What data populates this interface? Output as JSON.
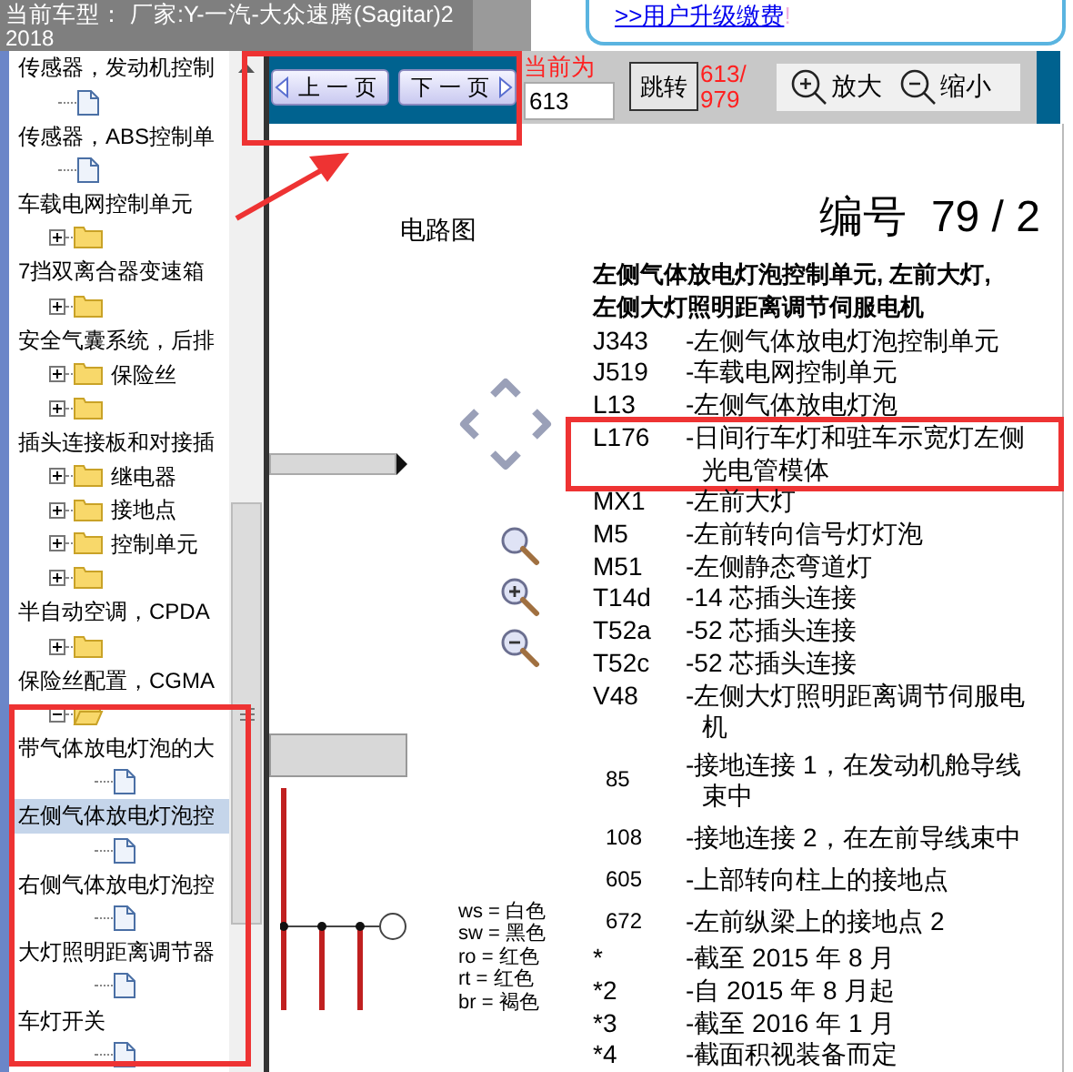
{
  "header": {
    "title": "当前车型：  厂家:Y-一汽-大众速腾(Sagitar)2",
    "title_line_2": "2018",
    "upgrade_link": ">>用户升级缴费",
    "upgrade_mark": "!"
  },
  "tree": [
    {
      "kind": "heading",
      "label": "传感器，发动机控制",
      "selected": false,
      "children": [
        {
          "kind": "doc"
        }
      ]
    },
    {
      "kind": "heading",
      "label": "传感器，ABS控制单",
      "selected": false,
      "children": [
        {
          "kind": "doc"
        }
      ]
    },
    {
      "kind": "heading",
      "label": "车载电网控制单元",
      "selected": false,
      "children": [
        {
          "kind": "folder",
          "expanded": false
        }
      ]
    },
    {
      "kind": "heading",
      "label": "7挡双离合器变速箱",
      "selected": false,
      "children": [
        {
          "kind": "folder",
          "expanded": false
        }
      ]
    },
    {
      "kind": "heading",
      "label": "安全气囊系统，后排",
      "selected": false,
      "children": [
        {
          "kind": "folder",
          "label": "保险丝",
          "expanded": false
        },
        {
          "kind": "folder",
          "expanded": false
        }
      ]
    },
    {
      "kind": "heading",
      "label": "插头连接板和对接插",
      "selected": false,
      "children": [
        {
          "kind": "folder",
          "label": "继电器",
          "expanded": false
        },
        {
          "kind": "folder",
          "label": "接地点",
          "expanded": false
        },
        {
          "kind": "folder",
          "label": "控制单元",
          "expanded": false
        },
        {
          "kind": "folder",
          "expanded": false
        }
      ]
    },
    {
      "kind": "heading",
      "label": "半自动空调，CPDA",
      "selected": false,
      "children": [
        {
          "kind": "folder",
          "expanded": false
        }
      ]
    },
    {
      "kind": "heading",
      "label": "保险丝配置，CGMA",
      "selected": false,
      "children": [
        {
          "kind": "folder",
          "expanded": true,
          "children": [
            {
              "kind": "heading",
              "label": "带气体放电灯泡的大",
              "selected": false,
              "children": [
                {
                  "kind": "doc"
                }
              ]
            },
            {
              "kind": "heading",
              "label": "左侧气体放电灯泡控",
              "selected": true,
              "children": [
                {
                  "kind": "doc"
                }
              ]
            },
            {
              "kind": "heading",
              "label": "右侧气体放电灯泡控",
              "selected": false,
              "children": [
                {
                  "kind": "doc"
                }
              ]
            },
            {
              "kind": "heading",
              "label": "大灯照明距离调节器",
              "selected": false,
              "children": [
                {
                  "kind": "doc"
                }
              ]
            },
            {
              "kind": "heading",
              "label": "车灯开关",
              "selected": false,
              "children": [
                {
                  "kind": "doc"
                }
              ]
            }
          ]
        }
      ]
    }
  ],
  "toolbar": {
    "prev": "上 一 页",
    "next": "下 一 页",
    "current_label": "当前为",
    "page_value": "613",
    "jump": "跳转",
    "page_status": [
      "613/",
      "979"
    ],
    "zoom_in": "放大",
    "zoom_out": "缩小"
  },
  "document": {
    "diagram_label": "电路图",
    "number": "编号  79 / 2",
    "heading": "左侧气体放电灯泡控制单元, 左前大灯, 左侧大灯照明距离调节伺服电机",
    "legend": [
      {
        "kind": "part",
        "code": "J343",
        "text": "-左侧气体放电灯泡控制单元",
        "highlighted": false
      },
      {
        "kind": "part",
        "code": "J519",
        "text": "-车载电网控制单元",
        "highlighted": false
      },
      {
        "kind": "part",
        "code": "L13",
        "text": "-左侧气体放电灯泡",
        "highlighted": false
      },
      {
        "kind": "part",
        "code": "L176",
        "text": "-日间行车灯和驻车示宽灯左侧光电管模体",
        "highlighted": true
      },
      {
        "kind": "part",
        "code": "MX1",
        "text": "-左前大灯",
        "highlighted": false
      },
      {
        "kind": "part",
        "code": "M5",
        "text": "-左前转向信号灯灯泡",
        "highlighted": false
      },
      {
        "kind": "part",
        "code": "M51",
        "text": "-左侧静态弯道灯",
        "highlighted": false
      },
      {
        "kind": "part",
        "code": "T14d",
        "text": "-14 芯插头连接",
        "highlighted": false
      },
      {
        "kind": "part",
        "code": "T52a",
        "text": "-52 芯插头连接",
        "highlighted": false
      },
      {
        "kind": "part",
        "code": "T52c",
        "text": "-52 芯插头连接",
        "highlighted": false
      },
      {
        "kind": "part",
        "code": "V48",
        "text": "-左侧大灯照明距离调节伺服电机",
        "highlighted": false
      },
      {
        "kind": "ground",
        "code": "85",
        "text": "-接地连接 1，在发动机舱导线束中",
        "highlighted": false
      },
      {
        "kind": "ground",
        "code": "108",
        "text": "-接地连接 2，在左前导线束中",
        "highlighted": false
      },
      {
        "kind": "ground",
        "code": "605",
        "text": "-上部转向柱上的接地点",
        "highlighted": false
      },
      {
        "kind": "ground",
        "code": "672",
        "text": "-左前纵梁上的接地点 2",
        "highlighted": false
      },
      {
        "kind": "part",
        "code": "*",
        "text": "-截至 2015 年 8 月",
        "highlighted": false
      },
      {
        "kind": "part",
        "code": "*2",
        "text": "-自 2015 年 8 月起",
        "highlighted": false
      },
      {
        "kind": "part",
        "code": "*3",
        "text": "-截至 2016 年 1 月",
        "highlighted": false
      },
      {
        "kind": "part",
        "code": "*4",
        "text": "-截面积视装备而定",
        "highlighted": false
      }
    ],
    "color_codes": [
      "ws = 白色",
      "sw = 黑色",
      "ro = 红色",
      "rt = 红色",
      "br = 褐色"
    ]
  }
}
